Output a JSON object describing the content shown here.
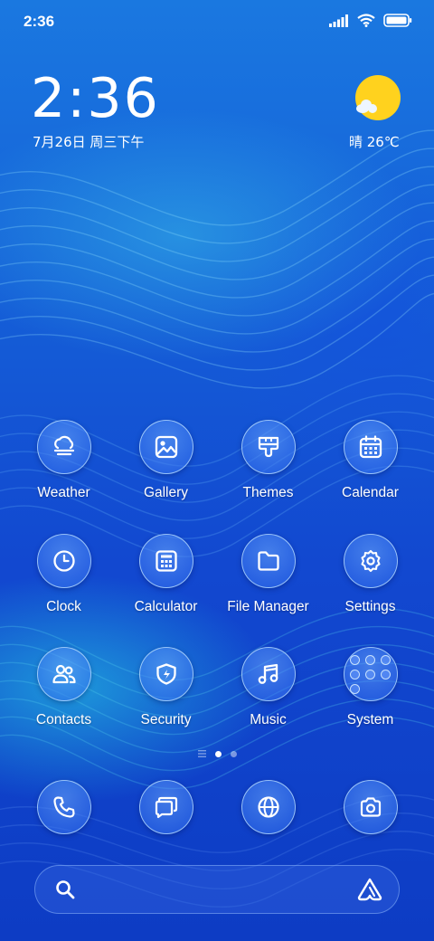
{
  "status_bar": {
    "time": "2:36",
    "icons": [
      "signal-icon",
      "wifi-icon",
      "battery-icon"
    ]
  },
  "clock_widget": {
    "time": "2:36",
    "date": "7月26日 周三下午",
    "weather": "晴 26℃",
    "weather_icon": "sunny-cloud-icon"
  },
  "apps": [
    {
      "label": "Weather",
      "icon": "cloud-fog-icon"
    },
    {
      "label": "Gallery",
      "icon": "image-icon"
    },
    {
      "label": "Themes",
      "icon": "paint-brush-icon"
    },
    {
      "label": "Calendar",
      "icon": "calendar-icon"
    },
    {
      "label": "Clock",
      "icon": "clock-icon"
    },
    {
      "label": "Calculator",
      "icon": "calculator-icon"
    },
    {
      "label": "File Manager",
      "icon": "folder-icon"
    },
    {
      "label": "Settings",
      "icon": "gear-icon"
    },
    {
      "label": "Contacts",
      "icon": "contacts-icon"
    },
    {
      "label": "Security",
      "icon": "shield-icon"
    },
    {
      "label": "Music",
      "icon": "music-note-icon"
    },
    {
      "label": "System",
      "icon": "folder-grid-icon"
    }
  ],
  "pager": {
    "pages": 3,
    "active_index": 1
  },
  "dock": [
    {
      "icon": "phone-icon"
    },
    {
      "icon": "messages-icon"
    },
    {
      "icon": "browser-globe-icon"
    },
    {
      "icon": "camera-icon"
    }
  ],
  "search_bar": {
    "left_icon": "search-icon",
    "right_icon": "assistant-icon"
  },
  "colors": {
    "background": "#1558d6",
    "accent_cyan": "#2ad8e6",
    "sun": "#ffd21e",
    "text": "#ffffff"
  }
}
